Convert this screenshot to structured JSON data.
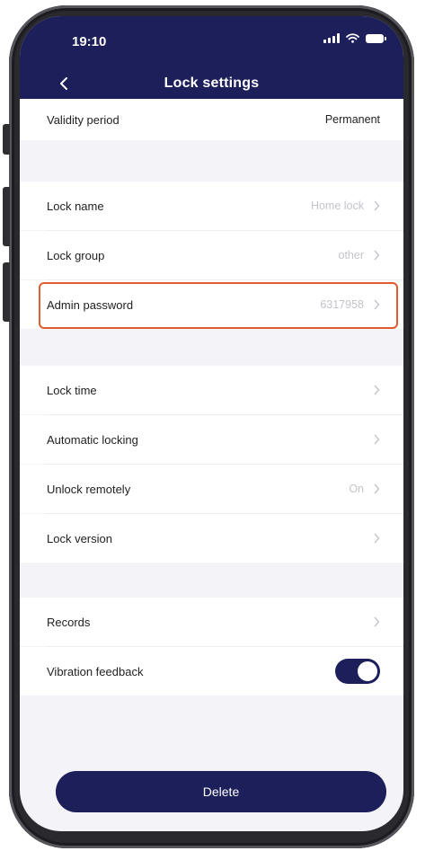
{
  "status_bar": {
    "time": "19:10"
  },
  "header": {
    "title": "Lock settings"
  },
  "rows": {
    "validity": {
      "label": "Validity period",
      "value": "Permanent"
    },
    "lock_name": {
      "label": "Lock name",
      "value": "Home lock"
    },
    "lock_group": {
      "label": "Lock group",
      "value": "other"
    },
    "admin_password": {
      "label": "Admin password",
      "value": "6317958"
    },
    "lock_time": {
      "label": "Lock time"
    },
    "auto_locking": {
      "label": "Automatic locking"
    },
    "unlock_remotely": {
      "label": "Unlock remotely",
      "value": "On"
    },
    "lock_version": {
      "label": "Lock version"
    },
    "records": {
      "label": "Records"
    },
    "vibration": {
      "label": "Vibration feedback",
      "enabled": true
    }
  },
  "delete_label": "Delete",
  "colors": {
    "header": "#1d1f5a",
    "accent": "#1d1f5a",
    "highlight": "#e35c2e",
    "background": "#f4f4f8"
  }
}
